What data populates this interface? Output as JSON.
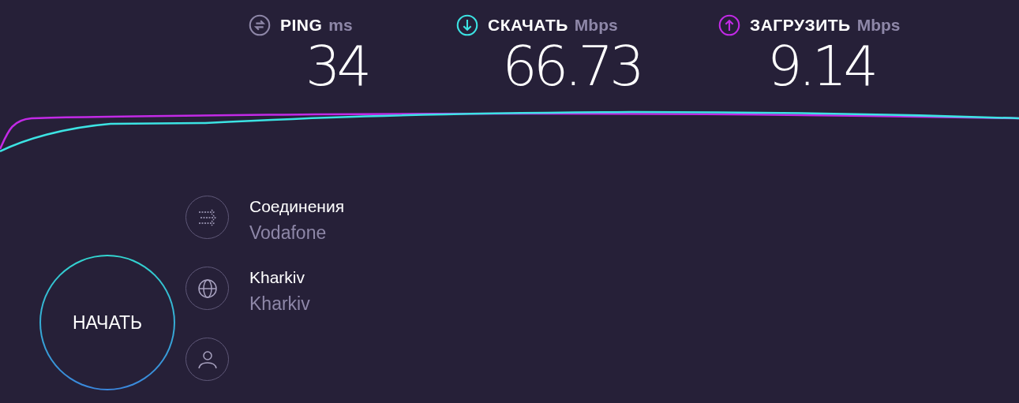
{
  "metrics": [
    {
      "kind": "ping",
      "label": "PING",
      "unit": "ms",
      "value": "34",
      "color": "#8e87a8"
    },
    {
      "kind": "download",
      "label": "СКАЧАТЬ",
      "unit": "Mbps",
      "value": "66.73",
      "color": "#3ce3e3"
    },
    {
      "kind": "upload",
      "label": "ЗАГРУЗИТЬ",
      "unit": "Mbps",
      "value": "9.14",
      "color": "#c22ae6"
    }
  ],
  "start_button": {
    "label": "НАЧАТЬ"
  },
  "info": [
    {
      "kind": "connections",
      "title": "Соединения",
      "subtitle": "Vodafone"
    },
    {
      "kind": "server",
      "title": "Kharkiv",
      "subtitle": "Kharkiv"
    },
    {
      "kind": "user"
    }
  ]
}
